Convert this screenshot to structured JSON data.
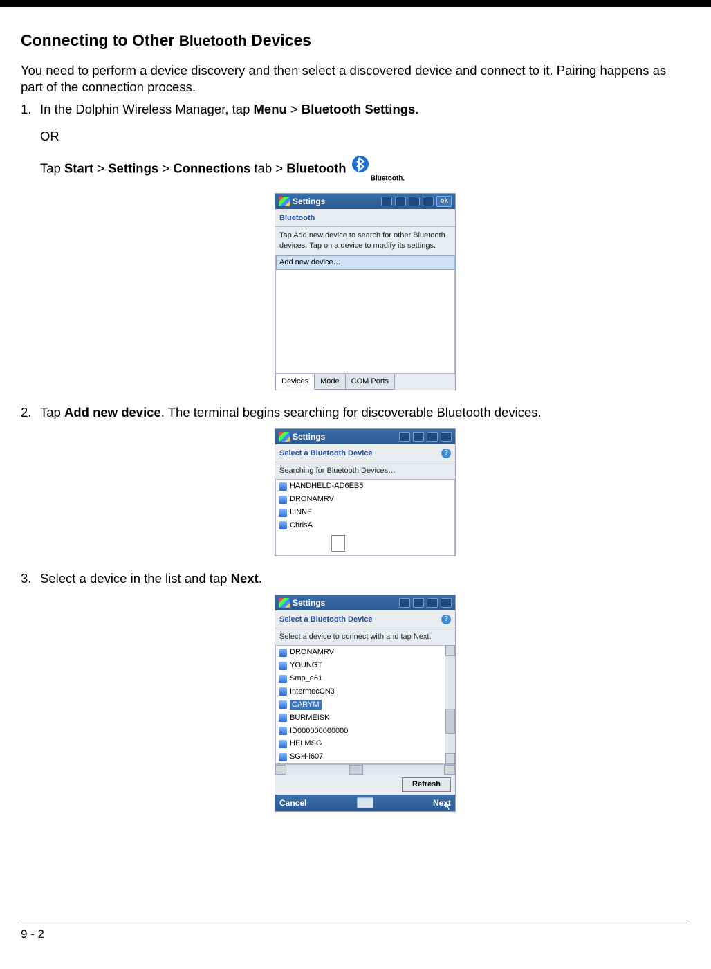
{
  "page": {
    "title_a": "Connecting to Other ",
    "title_bt": "Bluetooth",
    "title_b": " Devices",
    "intro": "You need to perform a device discovery and then select a discovered device and connect to it. Pairing happens as part of the connection process.",
    "footer": "9 - 2"
  },
  "step1": {
    "num": "1.",
    "pre": "In the Dolphin Wireless Manager, tap ",
    "menu": "Menu",
    "gt": " > ",
    "bts": "Bluetooth Settings",
    "dot": ".",
    "or": "OR",
    "tap": "Tap ",
    "start": "Start",
    "settings": "Settings",
    "conn": "Connections",
    "tab": " tab > ",
    "bt": "Bluetooth",
    "icon_label": "Bluetooth."
  },
  "step2": {
    "num": "2.",
    "pre": "Tap ",
    "add": "Add new device",
    "post": ". The terminal begins searching for discoverable Bluetooth devices."
  },
  "step3": {
    "num": "3.",
    "pre": "Select a device in the list and tap ",
    "next": "Next",
    "dot": "."
  },
  "ss1": {
    "title": "Settings",
    "ok": "ok",
    "sub": "Bluetooth",
    "text": "Tap Add new device to search for other Bluetooth devices. Tap on a device to modify its settings.",
    "add": "Add new device…",
    "tabs": {
      "devices": "Devices",
      "mode": "Mode",
      "com": "COM Ports"
    }
  },
  "ss2": {
    "title": "Settings",
    "sub": "Select a Bluetooth Device",
    "text": "Searching for Bluetooth Devices…",
    "items": [
      "HANDHELD-AD6EB5",
      "DRONAMRV",
      "LINNE",
      "ChrisA"
    ]
  },
  "ss3": {
    "title": "Settings",
    "sub": "Select a Bluetooth Device",
    "text": "Select a device to connect with and tap Next.",
    "items": [
      "DRONAMRV",
      "YOUNGT",
      "Smp_e61",
      "IntermecCN3",
      "CARYM",
      "BURMEISK",
      "ID000000000000",
      "HELMSG",
      "SGH-i607"
    ],
    "selected": "CARYM",
    "refresh": "Refresh",
    "cancel": "Cancel",
    "next": "Next"
  }
}
